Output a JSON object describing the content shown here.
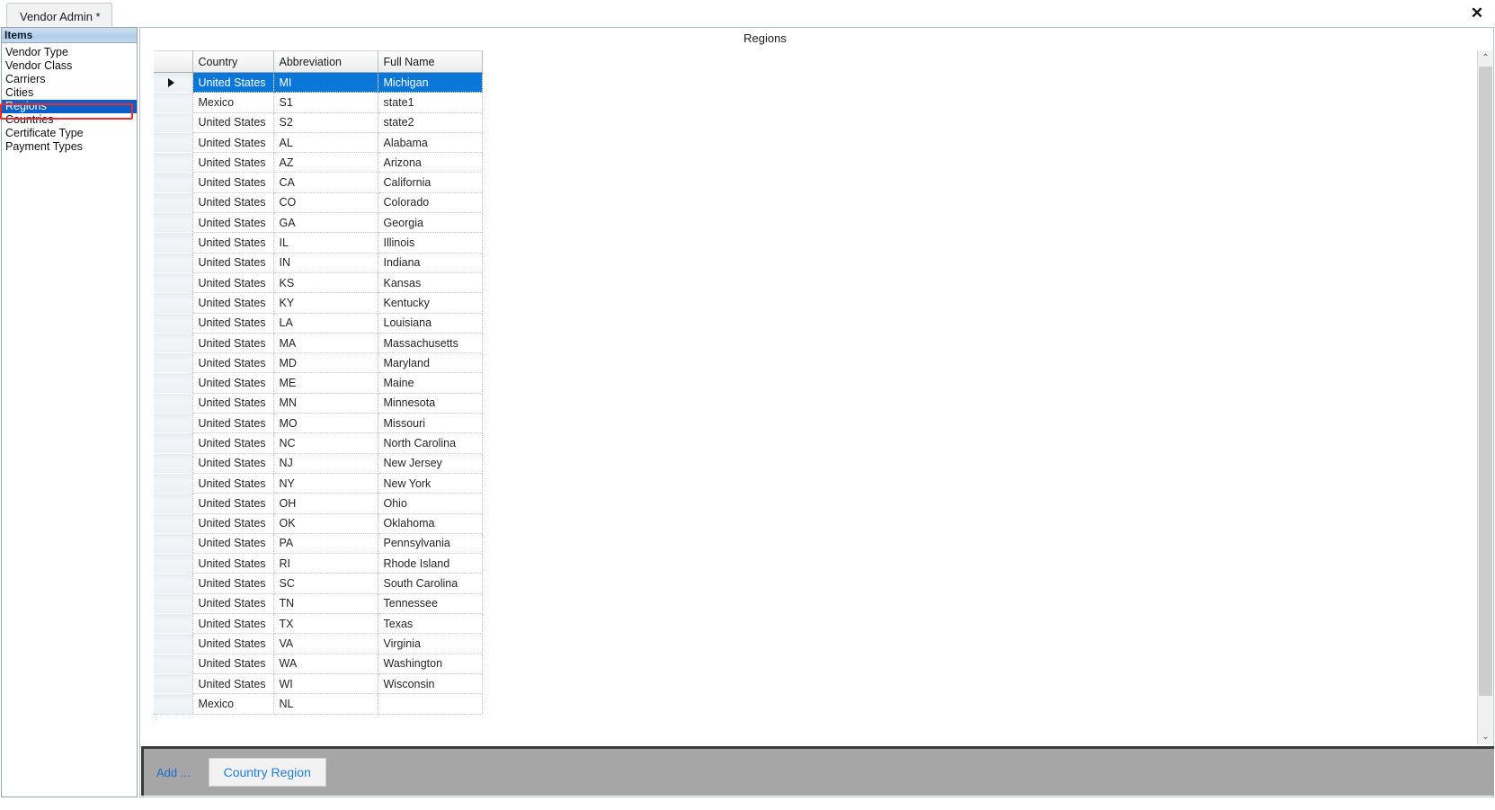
{
  "window": {
    "tab_label": "Vendor Admin *",
    "close_icon": "close-icon",
    "close_glyph": "✕"
  },
  "sidebar": {
    "header": "Items",
    "items": [
      {
        "label": "Vendor Type",
        "selected": false
      },
      {
        "label": "Vendor Class",
        "selected": false
      },
      {
        "label": "Carriers",
        "selected": false
      },
      {
        "label": "Cities",
        "selected": false
      },
      {
        "label": "Regions",
        "selected": true
      },
      {
        "label": "Countries",
        "selected": false
      },
      {
        "label": "Certificate Type",
        "selected": false
      },
      {
        "label": "Payment Types",
        "selected": false
      }
    ],
    "selected_index": 4,
    "highlight_color": "#0a60c8",
    "annotation_color": "#ee2b2b"
  },
  "main": {
    "title": "Regions",
    "grid": {
      "columns": [
        "Country",
        "Abbreviation",
        "Full Name"
      ],
      "selected_row_index": 0,
      "selection_color": "#0a76d8",
      "rows": [
        {
          "country": "United States",
          "abbreviation": "MI",
          "full_name": "Michigan"
        },
        {
          "country": "Mexico",
          "abbreviation": "S1",
          "full_name": "state1"
        },
        {
          "country": "United States",
          "abbreviation": "S2",
          "full_name": "state2"
        },
        {
          "country": "United States",
          "abbreviation": "AL",
          "full_name": "Alabama"
        },
        {
          "country": "United States",
          "abbreviation": "AZ",
          "full_name": "Arizona"
        },
        {
          "country": "United States",
          "abbreviation": "CA",
          "full_name": "California"
        },
        {
          "country": "United States",
          "abbreviation": "CO",
          "full_name": "Colorado"
        },
        {
          "country": "United States",
          "abbreviation": "GA",
          "full_name": "Georgia"
        },
        {
          "country": "United States",
          "abbreviation": "IL",
          "full_name": "Illinois"
        },
        {
          "country": "United States",
          "abbreviation": "IN",
          "full_name": "Indiana"
        },
        {
          "country": "United States",
          "abbreviation": "KS",
          "full_name": "Kansas"
        },
        {
          "country": "United States",
          "abbreviation": "KY",
          "full_name": "Kentucky"
        },
        {
          "country": "United States",
          "abbreviation": "LA",
          "full_name": "Louisiana"
        },
        {
          "country": "United States",
          "abbreviation": "MA",
          "full_name": "Massachusetts"
        },
        {
          "country": "United States",
          "abbreviation": "MD",
          "full_name": "Maryland"
        },
        {
          "country": "United States",
          "abbreviation": "ME",
          "full_name": "Maine"
        },
        {
          "country": "United States",
          "abbreviation": "MN",
          "full_name": "Minnesota"
        },
        {
          "country": "United States",
          "abbreviation": "MO",
          "full_name": "Missouri"
        },
        {
          "country": "United States",
          "abbreviation": "NC",
          "full_name": "North Carolina"
        },
        {
          "country": "United States",
          "abbreviation": "NJ",
          "full_name": "New Jersey"
        },
        {
          "country": "United States",
          "abbreviation": "NY",
          "full_name": "New York"
        },
        {
          "country": "United States",
          "abbreviation": "OH",
          "full_name": "Ohio"
        },
        {
          "country": "United States",
          "abbreviation": "OK",
          "full_name": "Oklahoma"
        },
        {
          "country": "United States",
          "abbreviation": "PA",
          "full_name": "Pennsylvania"
        },
        {
          "country": "United States",
          "abbreviation": "RI",
          "full_name": "Rhode Island"
        },
        {
          "country": "United States",
          "abbreviation": "SC",
          "full_name": "South Carolina"
        },
        {
          "country": "United States",
          "abbreviation": "TN",
          "full_name": "Tennessee"
        },
        {
          "country": "United States",
          "abbreviation": "TX",
          "full_name": "Texas"
        },
        {
          "country": "United States",
          "abbreviation": "VA",
          "full_name": "Virginia"
        },
        {
          "country": "United States",
          "abbreviation": "WA",
          "full_name": "Washington"
        },
        {
          "country": "United States",
          "abbreviation": "WI",
          "full_name": "Wisconsin"
        },
        {
          "country": "Mexico",
          "abbreviation": "NL",
          "full_name": ""
        }
      ]
    },
    "scrollbar": {
      "up_glyph": "⌃",
      "down_glyph": "⌄"
    }
  },
  "footer": {
    "add_label": "Add ...",
    "country_region_label": "Country Region"
  }
}
